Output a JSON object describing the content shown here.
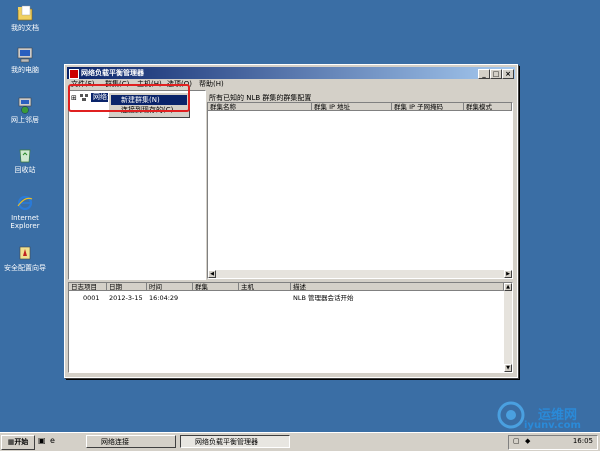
{
  "desktop": {
    "icons": [
      {
        "label": "我的文档",
        "icon": "folder-icon"
      },
      {
        "label": "我的电脑",
        "icon": "computer-icon"
      },
      {
        "label": "网上邻居",
        "icon": "network-icon"
      },
      {
        "label": "回收站",
        "icon": "recycle-bin-icon"
      },
      {
        "label": "Internet Explorer",
        "icon": "ie-icon"
      },
      {
        "label": "安全配置向导",
        "icon": "security-wizard-icon"
      }
    ]
  },
  "window": {
    "title": "网络负载平衡管理器",
    "controls": {
      "minimize": "_",
      "maximize": "□",
      "close": "×"
    },
    "menu": [
      "文件(F)",
      "群集(C)",
      "主机(H)",
      "选项(O)",
      "帮助(H)"
    ],
    "tree": {
      "root_label": "网络负载平衡群集"
    },
    "context_menu": {
      "items": [
        {
          "label": "新建群集(N)",
          "selected": true
        },
        {
          "label": "连接到现存的(C)",
          "selected": false
        }
      ]
    },
    "right_pane": {
      "caption": "所有已知的 NLB 群集的群集配置",
      "columns": [
        "群集名称",
        "群集 IP 地址",
        "群集 IP 子网掩码",
        "群集模式"
      ]
    },
    "log": {
      "columns": [
        "日志项目",
        "日期",
        "时间",
        "群集",
        "主机",
        "描述"
      ],
      "rows": [
        {
          "item": "0001",
          "date": "2012-3-15",
          "time": "16:04:29",
          "cluster": "",
          "host": "",
          "desc": "NLB 管理器会话开始"
        }
      ]
    }
  },
  "taskbar": {
    "start": "开始",
    "buttons": [
      {
        "label": "网络连接",
        "active": false
      },
      {
        "label": "网络负载平衡管理器",
        "active": true
      }
    ],
    "clock": "16:05"
  },
  "watermark": {
    "line1": "运维网",
    "line2": "iyunv.com"
  },
  "colors": {
    "desktop": "#3a6ea5",
    "titlebar": "#0a246a",
    "highlight_box": "#e02020"
  }
}
